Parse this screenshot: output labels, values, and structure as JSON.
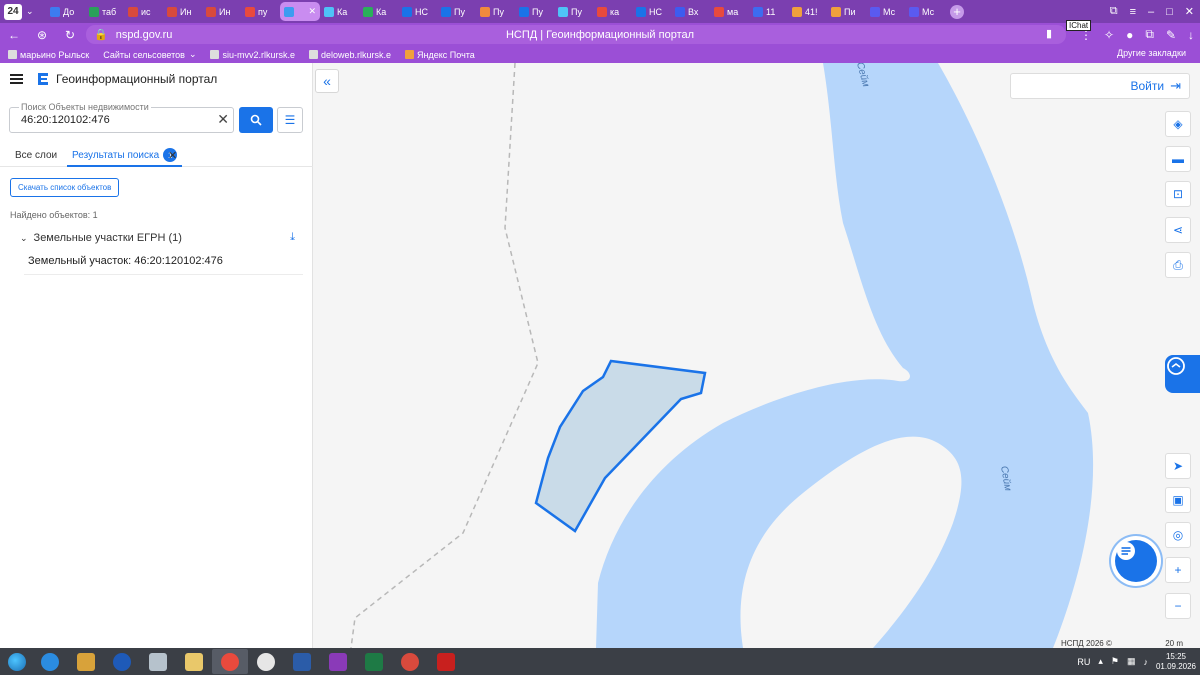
{
  "browser": {
    "tab_counter": "24",
    "tabs": [
      {
        "label": "До",
        "color": "#3d7cf0"
      },
      {
        "label": "таб",
        "color": "#2aa05a"
      },
      {
        "label": "ис",
        "color": "#d84a3d"
      },
      {
        "label": "Ин",
        "color": "#d84a3d"
      },
      {
        "label": "Ин",
        "color": "#d84a3d"
      },
      {
        "label": "пу",
        "color": "#e84a3d"
      },
      {
        "label": "",
        "color": "#3d9cf0"
      },
      {
        "label": "Ка",
        "color": "#4fc3f7"
      },
      {
        "label": "Ка",
        "color": "#2ab05a"
      },
      {
        "label": "НС",
        "color": "#1a73e8"
      },
      {
        "label": "Пу",
        "color": "#1a73e8"
      },
      {
        "label": "Пу",
        "color": "#f08a3d"
      },
      {
        "label": "Пу",
        "color": "#1a73e8"
      },
      {
        "label": "Пу",
        "color": "#4fc3f7"
      },
      {
        "label": "ка",
        "color": "#e84a3d"
      },
      {
        "label": "НС",
        "color": "#1a73e8"
      },
      {
        "label": "Вх",
        "color": "#3d5cf0"
      },
      {
        "label": "ма",
        "color": "#e84a3d"
      },
      {
        "label": "11",
        "color": "#3d6cf0"
      },
      {
        "label": "41!",
        "color": "#f0a03d"
      },
      {
        "label": "Пи",
        "color": "#f0a03d"
      },
      {
        "label": "Мс",
        "color": "#5a5af0"
      },
      {
        "label": "Мс",
        "color": "#5a5af0"
      }
    ],
    "active_tab_close": "✕",
    "url_host": "nspd.gov.ru",
    "page_title": "НСПД | Геоинформационный портал",
    "chat_label": "IChat",
    "bookmarks": [
      "марьино Рыльск",
      "Сайты сельсоветов",
      "siu-mvv2.rlkursk.e",
      "deloweb.rlkursk.e",
      "Яндекс Почта"
    ],
    "other_bookmarks": "Другие закладки"
  },
  "panel": {
    "title": "Геоинформационный портал",
    "search": {
      "placeholder": "Поиск Объекты недвижимости",
      "value": "46:20:120102:476"
    },
    "tabs": {
      "all_layers": "Все слои",
      "results": "Результаты поиска",
      "results_count": "1"
    },
    "download_button": "Скачать список объектов",
    "found_text": "Найдено объектов: 1",
    "group_label": "Земельные участки ЕГРН (1)",
    "item_label": "Земельный участок: 46:20:120102:476"
  },
  "map": {
    "login": "Войти",
    "river_label": "Сейм",
    "copyright": "НСПД 2026 ©",
    "scale": "20 m",
    "colors": {
      "water": "#b6d6fb",
      "parcel_fill": "#c9dbe8",
      "parcel_stroke": "#1a73e8",
      "accent": "#1a73e8"
    }
  },
  "taskbar": {
    "lang": "RU",
    "time": "15:25",
    "date": "01.09.2026"
  }
}
